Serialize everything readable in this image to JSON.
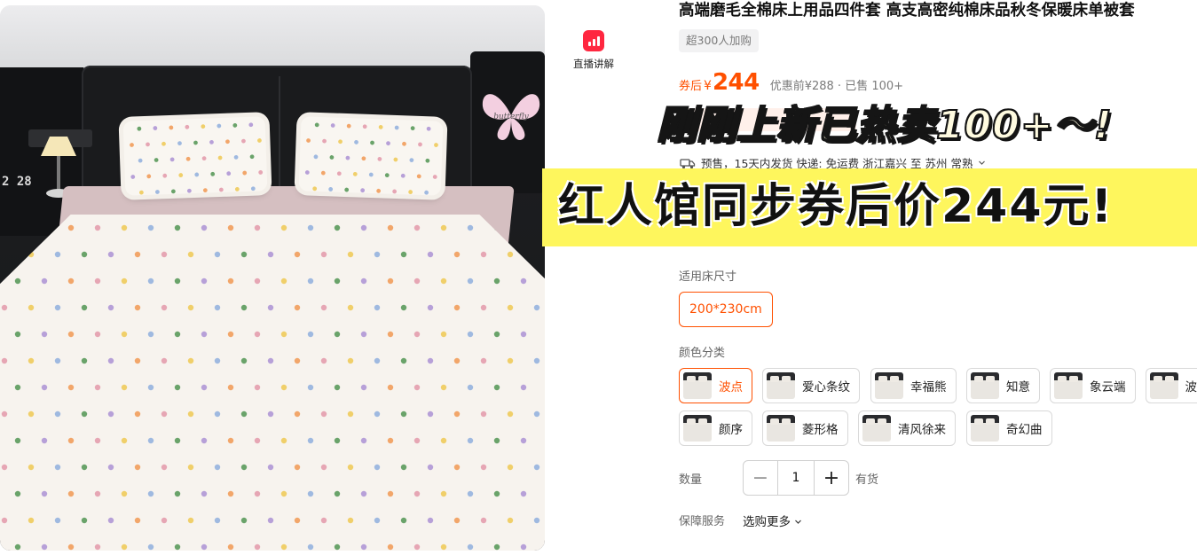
{
  "product": {
    "title": "高端磨毛全棉床上用品四件套 高支高密纯棉床品秋冬保暖床单被套",
    "buyers_badge": "超300人加购",
    "price_label": "券后",
    "currency": "¥",
    "price": "244",
    "original_info": "优惠前¥288 · 已售 100+"
  },
  "live": {
    "label": "直播讲解"
  },
  "shipping": {
    "text": "预售，15天内发货  快递: 免运费  浙江嘉兴 至 苏州 常熟",
    "chevron": "chevron-down-icon"
  },
  "overlay": {
    "headline": "刚刚上新已热卖100+～!",
    "banner": "红人馆同步券后价244元!"
  },
  "size": {
    "label": "适用床尺寸",
    "selected": "200*230cm"
  },
  "colors": {
    "label": "颜色分类",
    "options": [
      "波点",
      "爱心条纹",
      "幸福熊",
      "知意",
      "象云端",
      "波",
      "颜序",
      "菱形格",
      "清风徐来",
      "奇幻曲"
    ],
    "selected": "波点"
  },
  "quantity": {
    "label": "数量",
    "minus": "−",
    "value": "1",
    "plus": "+",
    "stock": "有货"
  },
  "guarantee": {
    "label": "保障服务",
    "link": "选购更多"
  },
  "photo": {
    "decor_text": "butterfly",
    "clock_text": "2 28"
  },
  "colors_theme": {
    "accent": "#ff5000",
    "live_red": "#ff2740",
    "banner_yellow": "#fef65d"
  }
}
